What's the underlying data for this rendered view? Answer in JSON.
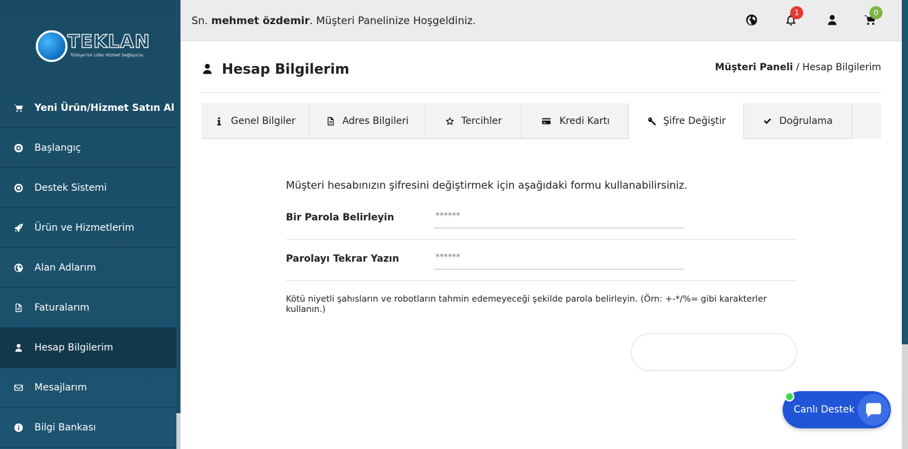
{
  "brand": {
    "name": "TEKLAN",
    "tagline": "Türkiye'nin Lider Hizmet Sağlayıcısı"
  },
  "sidebar": {
    "items": [
      {
        "label": "Yeni Ürün/Hizmet Satın Al",
        "icon": "cart-icon"
      },
      {
        "label": "Başlangıç",
        "icon": "gear-icon"
      },
      {
        "label": "Destek Sistemi",
        "icon": "lifebuoy-icon"
      },
      {
        "label": "Ürün ve Hizmetlerim",
        "icon": "rocket-icon"
      },
      {
        "label": "Alan Adlarım",
        "icon": "globe-icon"
      },
      {
        "label": "Faturalarım",
        "icon": "file-icon"
      },
      {
        "label": "Hesap Bilgilerim",
        "icon": "user-icon",
        "active": true
      },
      {
        "label": "Mesajlarım",
        "icon": "envelope-icon"
      },
      {
        "label": "Bilgi Bankası",
        "icon": "info-icon"
      }
    ]
  },
  "topbar": {
    "prefix": "Sn. ",
    "user_name": "mehmet özdemir",
    "welcome_suffix": ". Müşteri Panelinize Hoşgeldiniz.",
    "notification_count": "1",
    "cart_count": "0",
    "notification_badge_color": "#e53935",
    "cart_badge_color": "#7cb342"
  },
  "page": {
    "title": "Hesap Bilgilerim",
    "breadcrumb_root": "Müşteri Paneli",
    "breadcrumb_sep": " / ",
    "breadcrumb_current": "Hesap Bilgilerim"
  },
  "tabs": [
    {
      "label": "Genel Bilgiler",
      "icon": "info-icon"
    },
    {
      "label": "Adres Bilgileri",
      "icon": "document-icon"
    },
    {
      "label": "Tercihler",
      "icon": "star-icon"
    },
    {
      "label": "Kredi Kartı",
      "icon": "credit-card-icon"
    },
    {
      "label": "Şifre Değiştir",
      "icon": "key-icon",
      "active": true
    },
    {
      "label": "Doğrulama",
      "icon": "check-icon"
    }
  ],
  "form": {
    "intro": "Müşteri hesabınızın şifresini değiştirmek için aşağıdaki formu kullanabilirsiniz.",
    "password_label": "Bir Parola Belirleyin",
    "password_placeholder": "******",
    "confirm_label": "Parolayı Tekrar Yazın",
    "confirm_placeholder": "******",
    "hint": "Kötü niyetli şahısların ve robotların tahmin edemeyeceği şekilde parola belirleyin. (Örn: +-*/%= gibi karakterler kullanın.)",
    "submit_label": ""
  },
  "live_chat": {
    "label": "Canlı Destek",
    "status_color": "#3bd94a"
  }
}
